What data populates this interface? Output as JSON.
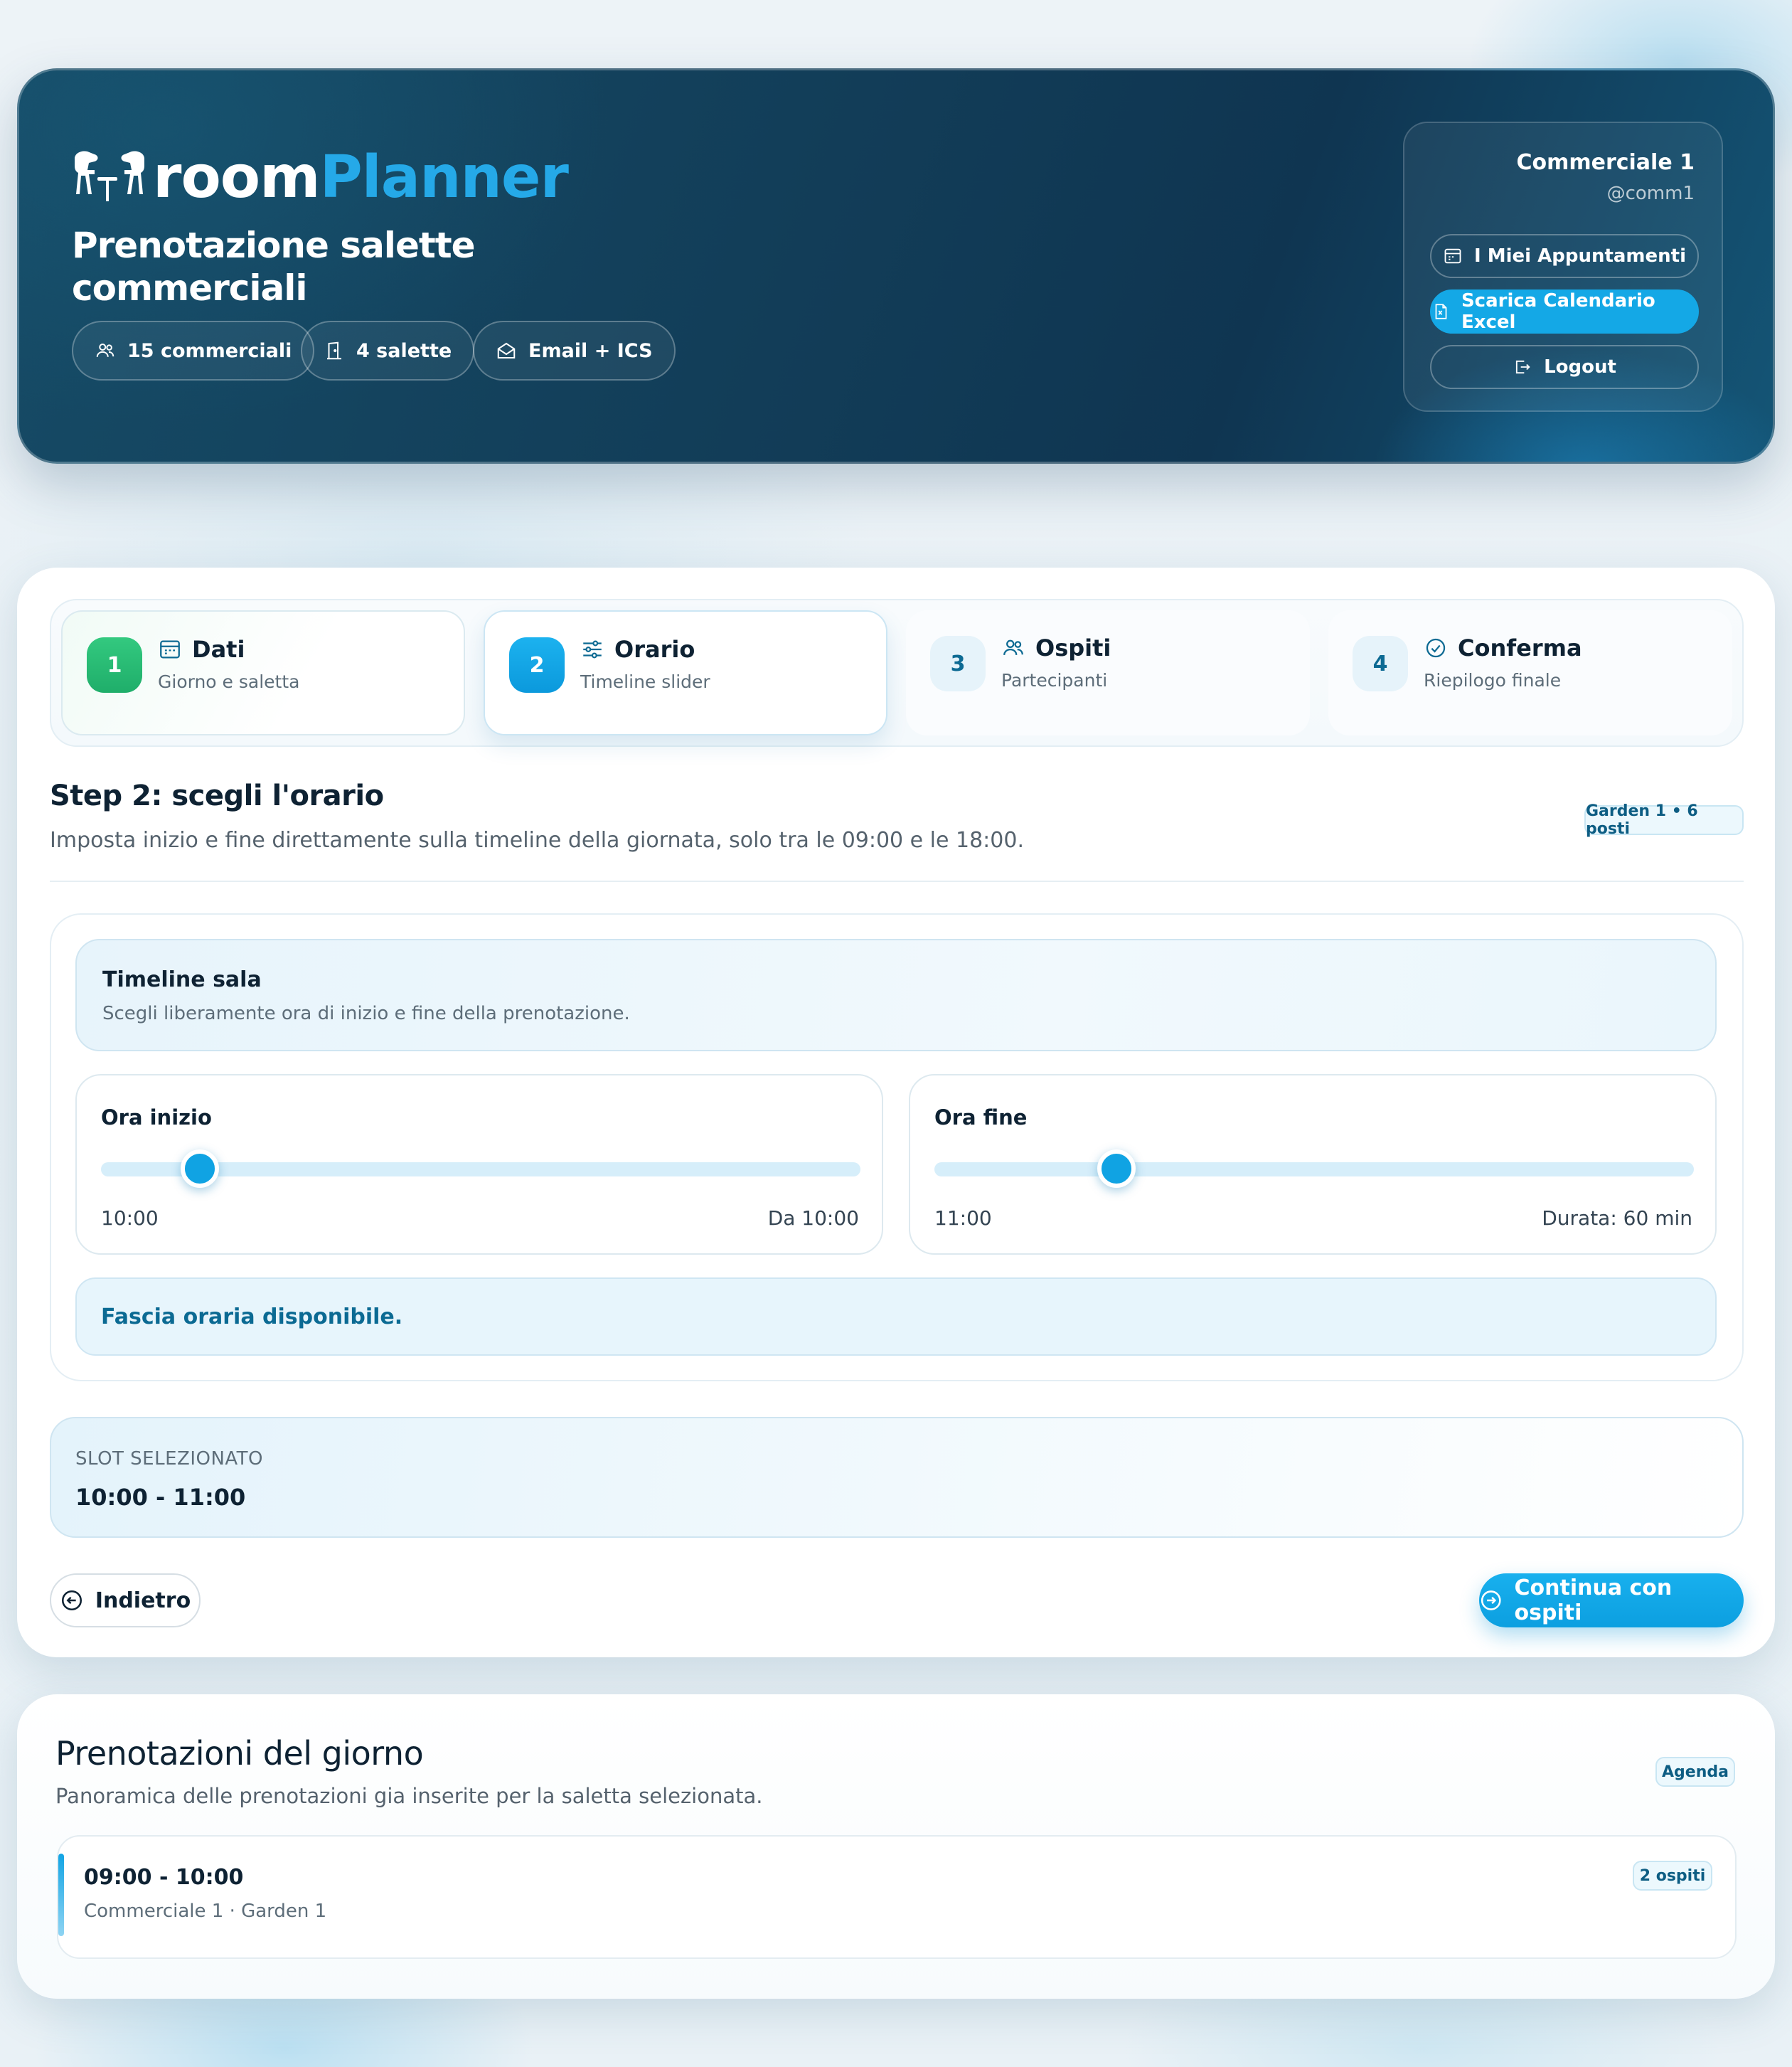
{
  "header": {
    "logo_part1": "room",
    "logo_part2": "Planner",
    "title": "Prenotazione salette commerciali",
    "chips": [
      {
        "label": "15 commerciali",
        "icon": "users-icon"
      },
      {
        "label": "4 salette",
        "icon": "door-icon"
      },
      {
        "label": "Email + ICS",
        "icon": "mail-icon"
      }
    ]
  },
  "user": {
    "name": "Commerciale 1",
    "handle": "@comm1",
    "appointments_label": "I Miei Appuntamenti",
    "download_label": "Scarica Calendario Excel",
    "logout_label": "Logout"
  },
  "steps": [
    {
      "num": "1",
      "title": "Dati",
      "sub": "Giorno e saletta",
      "state": "done",
      "icon": "calendar-icon"
    },
    {
      "num": "2",
      "title": "Orario",
      "sub": "Timeline slider",
      "state": "active",
      "icon": "sliders-icon"
    },
    {
      "num": "3",
      "title": "Ospiti",
      "sub": "Partecipanti",
      "state": "todo",
      "icon": "users-icon"
    },
    {
      "num": "4",
      "title": "Conferma",
      "sub": "Riepilogo finale",
      "state": "todo",
      "icon": "check-circle-icon"
    }
  ],
  "section": {
    "title": "Step 2: scegli l'orario",
    "lead": "Imposta inizio e fine direttamente sulla timeline della giornata, solo tra le 09:00 e le 18:00.",
    "room_badge": "Garden 1 • 6 posti"
  },
  "timeline": {
    "title": "Timeline sala",
    "sub": "Scegli liberamente ora di inizio e fine della prenotazione."
  },
  "start": {
    "label": "Ora inizio",
    "value": "10:00",
    "right": "Da 10:00",
    "position": 0.13
  },
  "end": {
    "label": "Ora fine",
    "value": "11:00",
    "right": "Durata: 60 min",
    "position": 0.24
  },
  "availability": "Fascia oraria disponibile.",
  "slot": {
    "label": "SLOT SELEZIONATO",
    "value": "10:00 - 11:00"
  },
  "actions": {
    "back_label": "Indietro",
    "next_label": "Continua con ospiti"
  },
  "bookings": {
    "title": "Prenotazioni del giorno",
    "sub": "Panoramica delle prenotazioni gia inserite per la saletta selezionata.",
    "badge": "Agenda",
    "items": [
      {
        "time": "09:00 - 10:00",
        "meta": "Commerciale 1 · Garden 1",
        "guests": "2 ospiti"
      }
    ]
  },
  "colors": {
    "accent": "#14a8e6",
    "hero_bg": "#123d58",
    "done": "#1fae6a",
    "text": "#0e2233"
  }
}
